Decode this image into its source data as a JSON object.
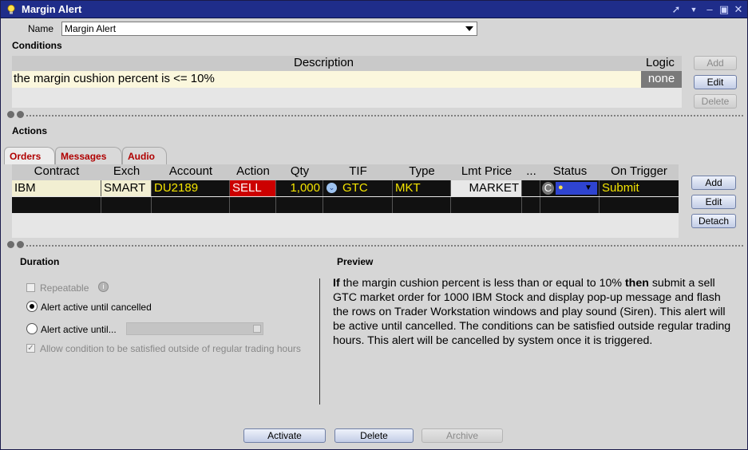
{
  "window": {
    "title": "Margin Alert"
  },
  "name_field": {
    "label": "Name",
    "value": "Margin Alert"
  },
  "conditions": {
    "section_label": "Conditions",
    "col_description": "Description",
    "col_logic": "Logic",
    "row": {
      "description": "the margin cushion percent is <= 10%",
      "logic": "none"
    },
    "buttons": {
      "add": "Add",
      "edit": "Edit",
      "delete": "Delete"
    }
  },
  "actions": {
    "section_label": "Actions",
    "tabs": [
      "Orders",
      "Messages",
      "Audio"
    ],
    "headers": [
      "Contract",
      "Exch",
      "Account",
      "Action",
      "Qty",
      "TIF",
      "Type",
      "Lmt Price",
      "...",
      "Status",
      "On Trigger"
    ],
    "order": {
      "contract": "IBM",
      "exch": "SMART",
      "account": "DU2189",
      "action": "SELL",
      "qty": "1,000",
      "tif": "GTC",
      "type": "MKT",
      "lmt_price": "MARKET",
      "status_letter": "C",
      "on_trigger": "Submit"
    },
    "buttons": {
      "add": "Add",
      "edit": "Edit",
      "detach": "Detach"
    }
  },
  "duration": {
    "section_label": "Duration",
    "repeatable": "Repeatable",
    "until_cancelled": "Alert active until cancelled",
    "until": "Alert active until...",
    "outside_rth": "Allow condition to be satisfied outside of regular trading hours"
  },
  "preview": {
    "section_label": "Preview",
    "if_word": "If",
    "text1": " the margin cushion percent is less than or equal to 10% ",
    "then_word": "then",
    "text2": " submit a sell GTC market order for 1000 IBM Stock and display pop-up message and flash the rows on Trader Workstation windows and play sound (Siren). This alert will be active until cancelled. The conditions can be satisfied outside regular trading hours. This alert will be cancelled by system once it is triggered."
  },
  "footer": {
    "activate": "Activate",
    "delete": "Delete",
    "archive": "Archive"
  },
  "colors": {
    "title_bar": "#1f2d8a",
    "sell_bg": "#cc0000",
    "account_yellow": "#f4e400",
    "tab_red": "#b00000"
  }
}
